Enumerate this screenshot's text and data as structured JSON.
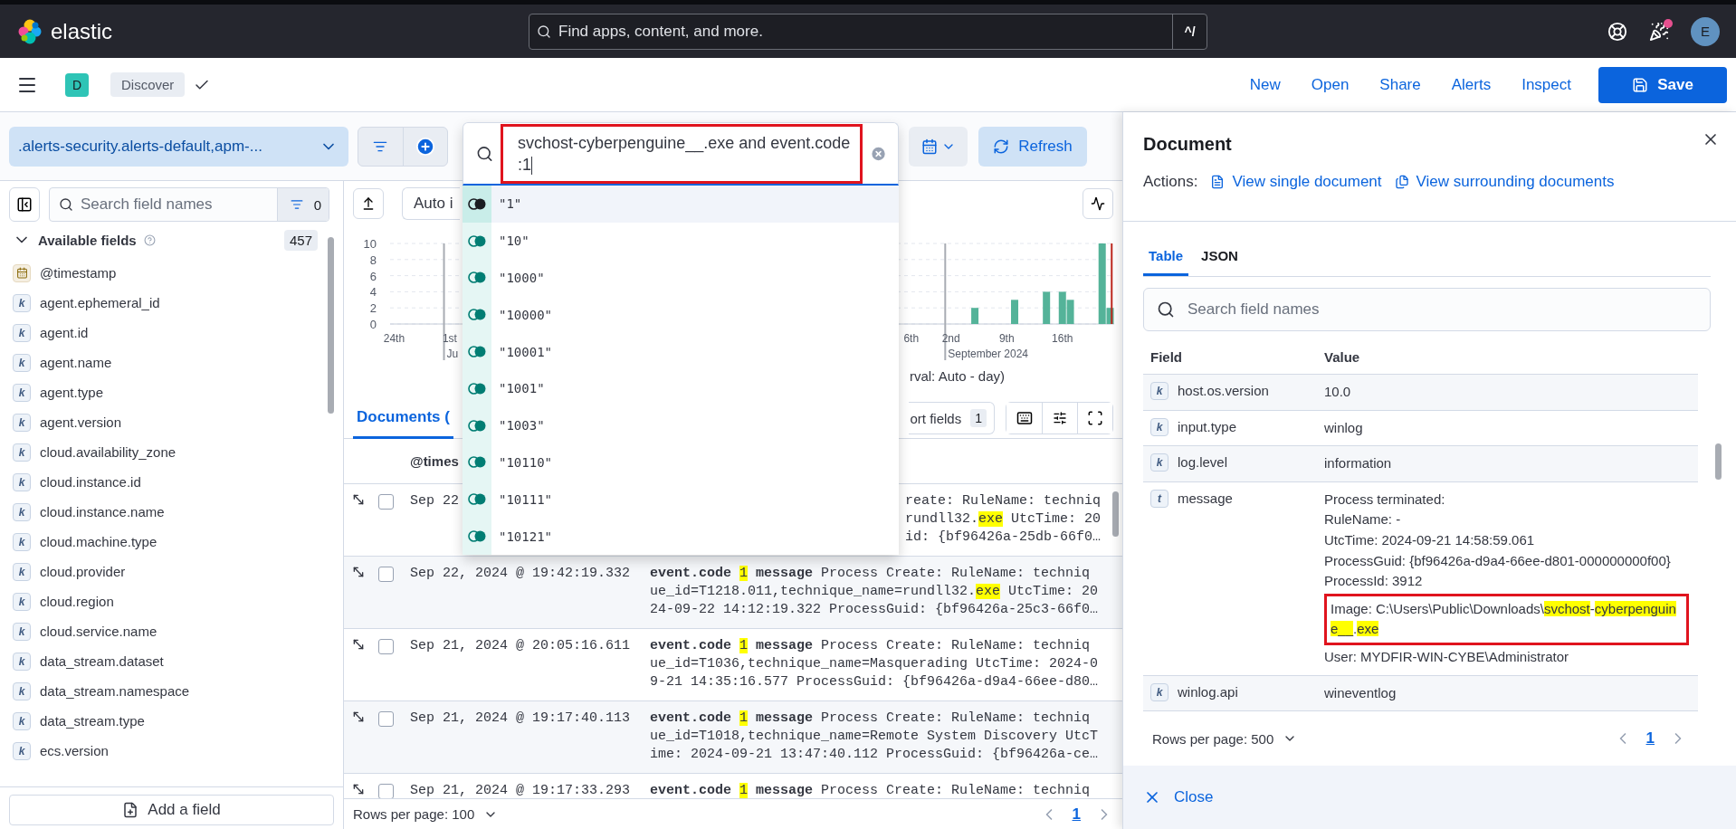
{
  "header": {
    "brand": "elastic",
    "search_placeholder": "Find apps, content, and more.",
    "shortcut": "^/",
    "news_unread": true,
    "avatar": "E"
  },
  "app_bar": {
    "space": "D",
    "breadcrumb": "Discover",
    "actions": [
      "New",
      "Open",
      "Share",
      "Alerts",
      "Inspect"
    ],
    "save": "Save"
  },
  "query_bar": {
    "data_view": ".alerts-security.alerts-default,apm-...",
    "query": "svchost-cyberpenguine__.exe and event.code :1",
    "query_annotated": true,
    "refresh": "Refresh"
  },
  "suggestions": [
    {
      "text": "\"1\"",
      "selected": true
    },
    {
      "text": "\"10\"",
      "selected": false
    },
    {
      "text": "\"1000\"",
      "selected": false
    },
    {
      "text": "\"10000\"",
      "selected": false
    },
    {
      "text": "\"10001\"",
      "selected": false
    },
    {
      "text": "\"1001\"",
      "selected": false
    },
    {
      "text": "\"1003\"",
      "selected": false
    },
    {
      "text": "\"10110\"",
      "selected": false
    },
    {
      "text": "\"10111\"",
      "selected": false
    },
    {
      "text": "\"10121\"",
      "selected": false
    }
  ],
  "sidebar": {
    "search_placeholder": "Search field names",
    "filter_count": "0",
    "section": {
      "title": "Available fields",
      "count": "457",
      "expanded": true
    },
    "fields": [
      {
        "name": "@timestamp",
        "kind": "date"
      },
      {
        "name": "agent.ephemeral_id",
        "kind": "token",
        "token": "k"
      },
      {
        "name": "agent.id",
        "kind": "token",
        "token": "k"
      },
      {
        "name": "agent.name",
        "kind": "token",
        "token": "k"
      },
      {
        "name": "agent.type",
        "kind": "token",
        "token": "k"
      },
      {
        "name": "agent.version",
        "kind": "token",
        "token": "k"
      },
      {
        "name": "cloud.availability_zone",
        "kind": "token",
        "token": "k"
      },
      {
        "name": "cloud.instance.id",
        "kind": "token",
        "token": "k"
      },
      {
        "name": "cloud.instance.name",
        "kind": "token",
        "token": "k"
      },
      {
        "name": "cloud.machine.type",
        "kind": "token",
        "token": "k"
      },
      {
        "name": "cloud.provider",
        "kind": "token",
        "token": "k"
      },
      {
        "name": "cloud.region",
        "kind": "token",
        "token": "k"
      },
      {
        "name": "cloud.service.name",
        "kind": "token",
        "token": "k"
      },
      {
        "name": "data_stream.dataset",
        "kind": "token",
        "token": "k"
      },
      {
        "name": "data_stream.namespace",
        "kind": "token",
        "token": "k"
      },
      {
        "name": "data_stream.type",
        "kind": "token",
        "token": "k"
      },
      {
        "name": "ecs.version",
        "kind": "token",
        "token": "k"
      }
    ],
    "add_field": "Add a field"
  },
  "histogram": {
    "interval_button": "Auto i",
    "interval_note": "rval: Auto - day)",
    "chart_data": {
      "type": "bar",
      "ylim": [
        0,
        10
      ],
      "yticks": [
        0,
        2,
        4,
        6,
        8,
        10
      ],
      "grid": true,
      "categories": [
        "24th",
        null,
        null,
        null,
        null,
        null,
        null,
        "1st",
        null,
        null,
        null,
        null,
        null,
        null,
        null,
        null,
        null,
        null,
        null,
        null,
        null,
        null,
        null,
        null,
        null,
        null,
        null,
        null,
        null,
        null,
        null,
        null,
        null,
        null,
        null,
        null,
        null,
        null,
        null,
        null,
        null,
        null,
        null,
        null,
        null,
        null,
        null,
        null,
        null,
        null,
        null,
        null,
        null,
        null,
        null,
        null,
        null,
        null,
        null,
        null,
        null,
        null,
        null,
        null,
        null,
        "6th",
        null,
        null,
        null,
        null,
        "2nd",
        null,
        null,
        null,
        null,
        null,
        null,
        "9th",
        null,
        null,
        null,
        null,
        null,
        null,
        "16th",
        null,
        null,
        null,
        null,
        null,
        null
      ],
      "values": [
        null,
        null,
        null,
        null,
        null,
        null,
        null,
        null,
        null,
        null,
        null,
        null,
        null,
        null,
        null,
        null,
        null,
        null,
        null,
        null,
        null,
        null,
        null,
        null,
        null,
        null,
        null,
        null,
        null,
        null,
        null,
        null,
        null,
        null,
        null,
        null,
        null,
        null,
        null,
        null,
        null,
        null,
        null,
        null,
        null,
        null,
        null,
        null,
        null,
        null,
        null,
        null,
        null,
        null,
        null,
        null,
        null,
        null,
        null,
        null,
        null,
        null,
        null,
        null,
        null,
        null,
        null,
        null,
        null,
        null,
        null,
        null,
        null,
        2,
        null,
        null,
        null,
        null,
        3,
        null,
        null,
        null,
        4,
        null,
        4,
        3,
        null,
        null,
        null,
        10,
        2
      ],
      "annotations": [
        "Ju",
        "September 2024"
      ]
    }
  },
  "documents": {
    "tab": {
      "label": "Documents (",
      "selected": true
    },
    "sort_fields": "ort fields",
    "sort_count": "1",
    "column": "@times",
    "rows": [
      {
        "timestamp": "Sep 22",
        "checked": false,
        "clipped": true,
        "lines": [
          [
            {
              "t": "reate: RuleName: techniq"
            }
          ],
          [
            {
              "t": "rundll32."
            },
            {
              "t": "exe",
              "highlighted": true
            },
            {
              "t": " UtcTime: 20"
            }
          ],
          [
            {
              "t": "id: {bf96426a-25db-66f0…"
            }
          ]
        ]
      },
      {
        "timestamp": "Sep 22, 2024 @ 19:42:19.332",
        "checked": false,
        "clipped": false,
        "lines": [
          [
            {
              "t": "event.code ",
              "bold": true
            },
            {
              "t": "1",
              "highlighted": true
            },
            {
              "t": " message",
              "bold": true
            },
            {
              "t": " Process Create: RuleName: techniq"
            }
          ],
          [
            {
              "t": "ue_id=T1218.011,technique_name=rundll32."
            },
            {
              "t": "exe",
              "highlighted": true
            },
            {
              "t": " UtcTime: 20"
            }
          ],
          [
            {
              "t": "24-09-22 14:12:19.322 ProcessGuid: {bf96426a-25c3-66f0…"
            }
          ]
        ]
      },
      {
        "timestamp": "Sep 21, 2024 @ 20:05:16.611",
        "checked": false,
        "clipped": false,
        "lines": [
          [
            {
              "t": "event.code ",
              "bold": true
            },
            {
              "t": "1",
              "highlighted": true
            },
            {
              "t": " message",
              "bold": true
            },
            {
              "t": " Process Create: RuleName: techniq"
            }
          ],
          [
            {
              "t": "ue_id=T1036,technique_name=Masquerading UtcTime: 2024-0"
            }
          ],
          [
            {
              "t": "9-21 14:35:16.577 ProcessGuid: {bf96426a-d9a4-66ee-d80…"
            }
          ]
        ]
      },
      {
        "timestamp": "Sep 21, 2024 @ 19:17:40.113",
        "checked": false,
        "clipped": false,
        "lines": [
          [
            {
              "t": "event.code ",
              "bold": true
            },
            {
              "t": "1",
              "highlighted": true
            },
            {
              "t": " message",
              "bold": true
            },
            {
              "t": " Process Create: RuleName: techniq"
            }
          ],
          [
            {
              "t": "ue_id=T1018,technique_name=Remote System Discovery UtcT"
            }
          ],
          [
            {
              "t": "ime: 2024-09-21 13:47:40.112 ProcessGuid: {bf96426a-ce…"
            }
          ]
        ]
      },
      {
        "timestamp": "Sep 21, 2024 @ 19:17:33.293",
        "checked": false,
        "clipped": false,
        "lines": [
          [
            {
              "t": "event.code ",
              "bold": true
            },
            {
              "t": "1",
              "highlighted": true
            },
            {
              "t": " message",
              "bold": true
            },
            {
              "t": " Process Create: RuleName: techniq"
            }
          ]
        ]
      }
    ],
    "rows_per_page": "Rows per page: 100",
    "page": "1"
  },
  "flyout": {
    "title": "Document",
    "actions_label": "Actions:",
    "actions": [
      "View single document",
      "View surrounding documents"
    ],
    "tabs": [
      {
        "label": "Table",
        "selected": true
      },
      {
        "label": "JSON",
        "selected": false
      }
    ],
    "search_placeholder": "Search field names",
    "columns": [
      "Field",
      "Value"
    ],
    "rows": [
      {
        "field": "host.os.version",
        "token": "k",
        "kind": "plain",
        "value": "10.0"
      },
      {
        "field": "input.type",
        "token": "k",
        "kind": "plain",
        "value": "winlog"
      },
      {
        "field": "log.level",
        "token": "k",
        "kind": "plain",
        "value": "information"
      },
      {
        "field": "message",
        "token": "t",
        "kind": "multiline",
        "lines": [
          {
            "parts": [
              {
                "t": "Process terminated:"
              }
            ],
            "boxed": false
          },
          {
            "parts": [
              {
                "t": "RuleName: -"
              }
            ],
            "boxed": false
          },
          {
            "parts": [
              {
                "t": "UtcTime: 2024-09-21 14:58:59.061"
              }
            ],
            "boxed": false
          },
          {
            "parts": [
              {
                "t": "ProcessGuid: {bf96426a-d9a4-66ee-d801-000000000f00}"
              }
            ],
            "boxed": false
          },
          {
            "parts": [
              {
                "t": "ProcessId: 3912"
              }
            ],
            "boxed": false
          },
          {
            "parts": [
              {
                "t": "Image: C:\\Users\\Public\\Downloads\\"
              },
              {
                "t": "svchost",
                "highlighted": true
              },
              {
                "t": "-"
              },
              {
                "t": "cyberpenguine__",
                "highlighted": true
              },
              {
                "t": "."
              },
              {
                "t": "exe",
                "highlighted": true
              }
            ],
            "boxed": true
          },
          {
            "parts": [
              {
                "t": "User: MYDFIR-WIN-CYBE\\Administrator"
              }
            ],
            "boxed": false
          }
        ]
      },
      {
        "field": "winlog.api",
        "token": "k",
        "kind": "plain",
        "value": "wineventlog"
      }
    ],
    "rows_per_page": "Rows per page: 500",
    "page": "1",
    "close": "Close"
  }
}
